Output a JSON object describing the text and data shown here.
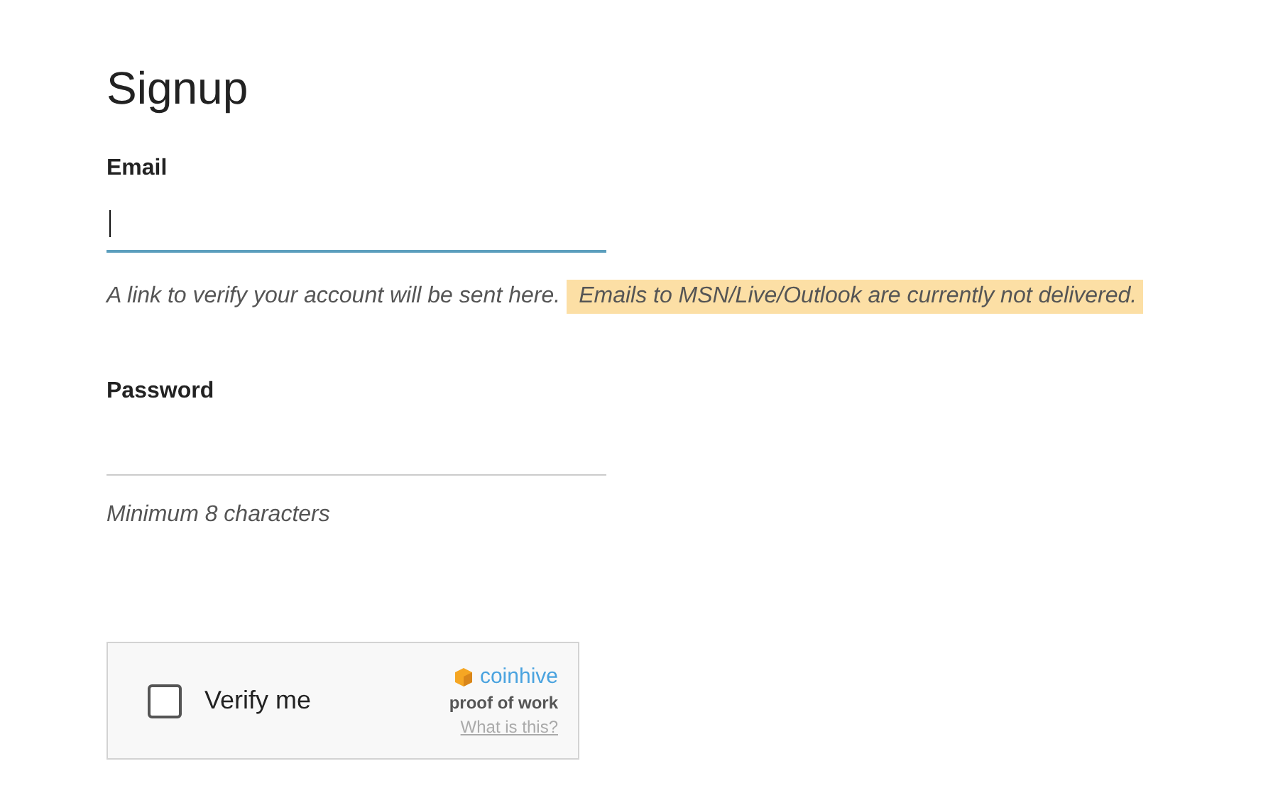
{
  "title": "Signup",
  "fields": [
    {
      "label": "Email",
      "focused": true,
      "hint": "A link to verify your account will be sent here.",
      "notice": "Emails to MSN/Live/Outlook are currently not delivered."
    },
    {
      "label": "Password",
      "focused": false,
      "hint": "Minimum 8 characters"
    }
  ],
  "captcha": {
    "label": "Verify me",
    "checked": false,
    "brand": "coinhive",
    "tagline": "proof of work",
    "link": "What is this?"
  }
}
